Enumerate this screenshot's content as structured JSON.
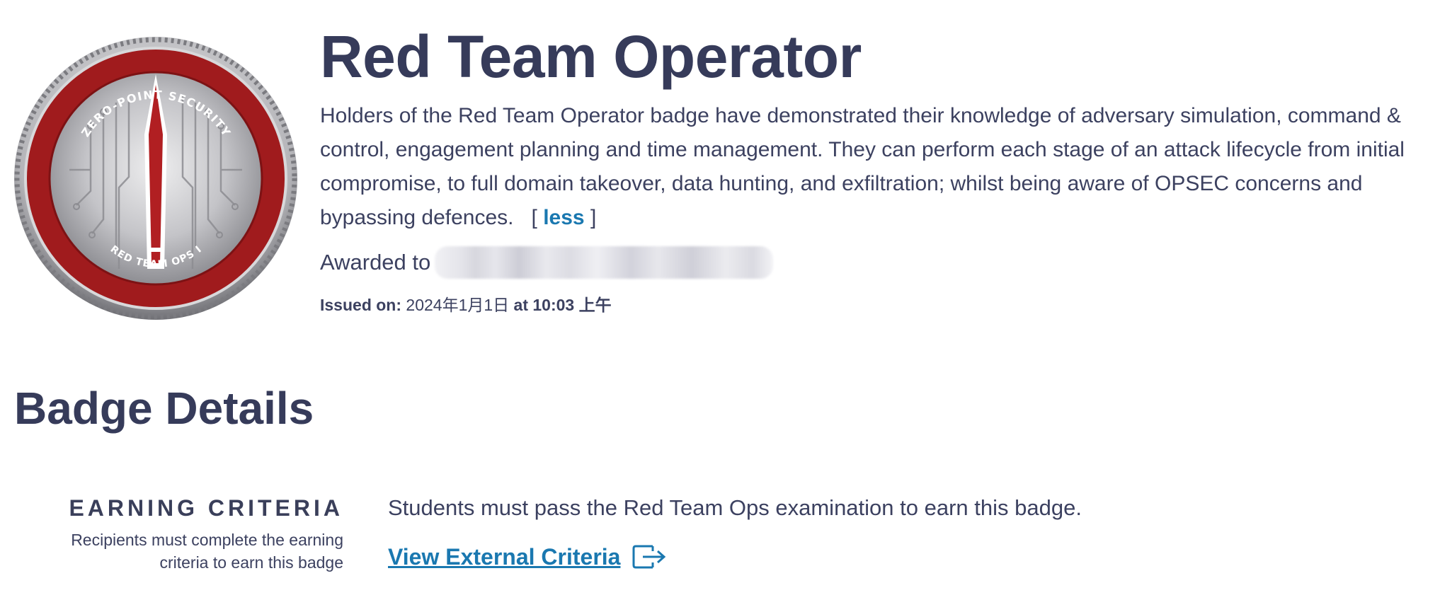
{
  "badge": {
    "image_name": "red-team-ops-coin",
    "ring_top_text": "ZERO-POINT SECURITY",
    "ring_bottom_text": "RED TEAM OPS I",
    "colors": {
      "ring": "#a01b1d",
      "metal": "#c9c9cc"
    }
  },
  "hero": {
    "title": "Red Team Operator",
    "description": "Holders of the Red Team Operator badge have demonstrated their knowledge of adversary simulation, command & control, engagement planning and time management. They can perform each stage of an attack lifecycle from initial compromise, to full domain takeover, data hunting, and exfiltration; whilst being aware of OPSEC concerns and bypassing defences.",
    "less_open": "[",
    "less_label": "less",
    "less_close": "]",
    "awarded_label": "Awarded to",
    "issued_label": "Issued on:",
    "issued_date": "2024年1月1日",
    "issued_at": "at",
    "issued_time": "10:03 上午"
  },
  "details": {
    "section_title": "Badge Details",
    "criteria_heading": "EARNING CRITERIA",
    "criteria_sub": "Recipients must complete the earning criteria to earn this badge",
    "criteria_text": "Students must pass the Red Team Ops examination to earn this badge.",
    "external_link_label": "View External Criteria",
    "external_icon": "external-link-icon"
  },
  "colors": {
    "heading": "#363b5a",
    "link": "#1a78b0",
    "text": "#3c4160"
  }
}
